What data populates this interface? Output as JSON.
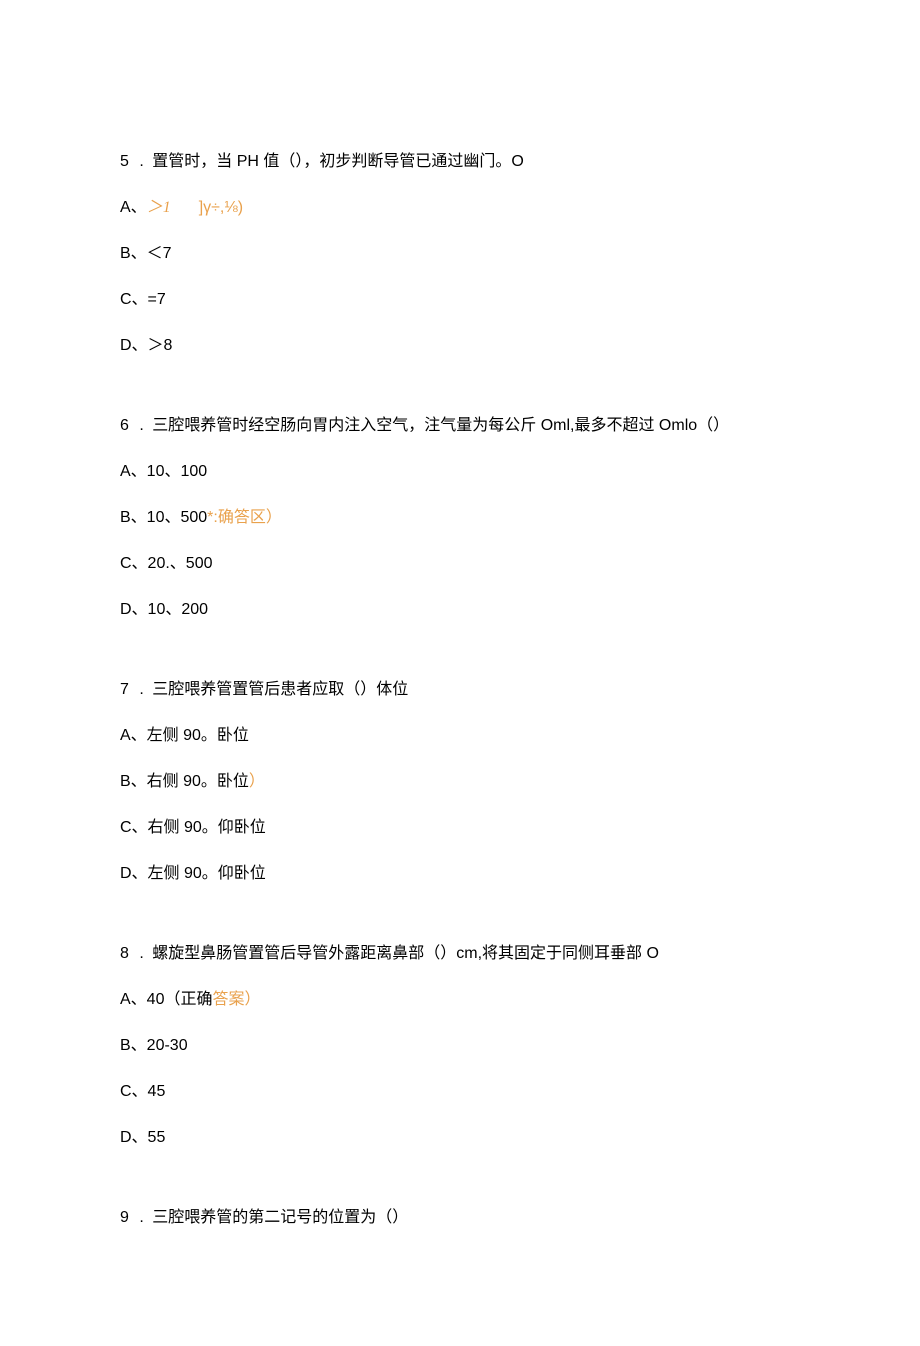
{
  "q5": {
    "num": "5",
    "dot": ".",
    "text": "置管时，当 PH 值（），初步判断导管已通过幽门。O",
    "optA_prefix": "A、",
    "optA_val": "＞1",
    "optA_frag": "]γ÷,⅛)",
    "optB": "B、＜7",
    "optC": "C、=7",
    "optD": "D、＞8"
  },
  "q6": {
    "num": "6",
    "dot": ".",
    "text": "三腔喂养管时经空肠向胃内注入空气，注气量为每公斤 Oml,最多不超过 Omlo（）",
    "optA": "A、10、100",
    "optB_prefix": "B、10、500",
    "optB_star": "*",
    "optB_hint": ":确答区）",
    "optC": "C、20.、500",
    "optD": "D、10、200"
  },
  "q7": {
    "num": "7",
    "dot": ".",
    "text": "三腔喂养管置管后患者应取（）体位",
    "optA": "A、左侧 90。卧位",
    "optB": "B、右侧 90。卧位",
    "optB_tail": "）",
    "optC": "C、右侧 90。仰卧位",
    "optD": "D、左侧 90。仰卧位"
  },
  "q8": {
    "num": "8",
    "dot": ".",
    "text": "螺旋型鼻肠管置管后导管外露距离鼻部（）cm,将其固定于同侧耳垂部 O",
    "optA_prefix": "A、40（正确",
    "optA_hint": "答案）",
    "optB": "B、20-30",
    "optC": "C、45",
    "optD": "D、55"
  },
  "q9": {
    "num": "9",
    "dot": ".",
    "text": "三腔喂养管的第二记号的位置为（）"
  }
}
